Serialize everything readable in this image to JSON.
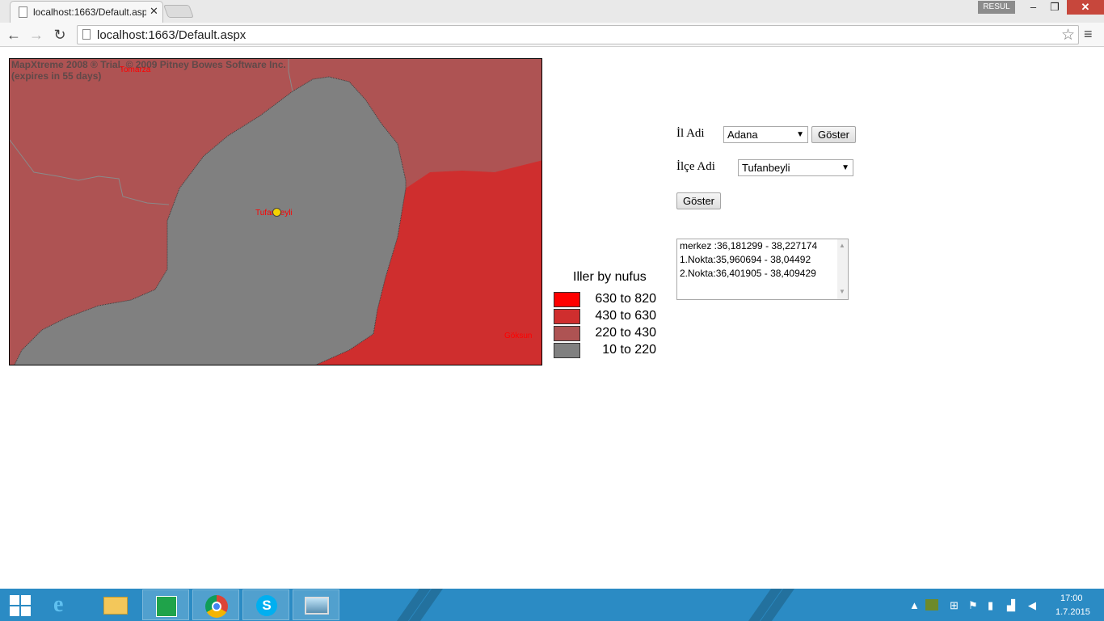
{
  "browser": {
    "tab_title": "localhost:1663/Default.aspx",
    "tab_close": "✕",
    "user_badge": "RESUL",
    "min_label": "–",
    "max_label": "❐",
    "close_label": "✕",
    "back_icon": "←",
    "forward_icon": "→",
    "reload_icon": "↻",
    "star_icon": "☆",
    "menu_icon": "≡",
    "url": "localhost:1663/Default.aspx"
  },
  "map": {
    "watermark": "MapXtreme 2008 ® Trial, © 2009 Pitney Bowes Software Inc.\n(expires in 55 days)",
    "labels": {
      "tomarza": "Tomarza",
      "tufanbeyli": "Tufanbeyli",
      "goksun": "Göksun"
    },
    "colors": {
      "band1": "#ff0000",
      "band2": "#cf2e2e",
      "band3": "#ae5353",
      "band4": "#808080"
    }
  },
  "legend": {
    "title": "Iller by nufus",
    "items": [
      {
        "label": "630 to 820",
        "color": "#ff0000"
      },
      {
        "label": "430 to 630",
        "color": "#cf2e2e"
      },
      {
        "label": "220 to 430",
        "color": "#ae5353"
      },
      {
        "label": "10 to 220",
        "color": "#808080"
      }
    ]
  },
  "form": {
    "il_label": "İl Adi",
    "il_value": "Adana",
    "goster_1": "Göster",
    "ilce_label": "İlçe Adi",
    "ilce_value": "Tufanbeyli",
    "goster_2": "Göster",
    "coords": [
      "merkez :36,181299 - 38,227174",
      "1.Nokta:35,960694 - 38,04492",
      "2.Nokta:36,401905 - 38,409429"
    ]
  },
  "taskbar": {
    "time": "17:00",
    "date": "1.7.2015",
    "apps": [
      "internet-explorer-icon",
      "file-explorer-icon",
      "store-icon",
      "chrome-icon",
      "skype-icon",
      "photos-icon"
    ]
  }
}
